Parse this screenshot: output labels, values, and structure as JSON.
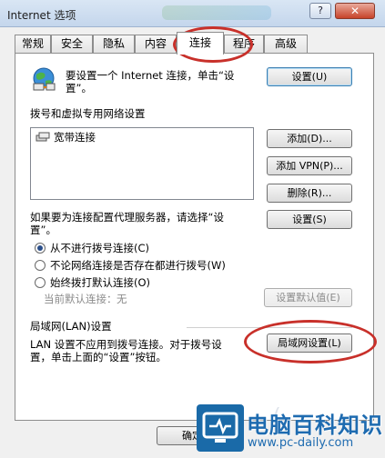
{
  "window": {
    "title": "Internet 选项",
    "help_label": "?",
    "close_label": "✕"
  },
  "tabs": [
    {
      "label": "常规"
    },
    {
      "label": "安全"
    },
    {
      "label": "隐私"
    },
    {
      "label": "内容"
    },
    {
      "label": "连接",
      "active": true
    },
    {
      "label": "程序"
    },
    {
      "label": "高级"
    }
  ],
  "setup": {
    "icon": "globe-network-icon",
    "text_line1": "要设置一个 Internet 连接，单击“设",
    "text_line2": "置”。",
    "button": "设置(U)"
  },
  "dialup": {
    "heading": "拨号和虚拟专用网络设置",
    "list_items": [
      {
        "icon": "broadband-connection-icon",
        "label": "宽带连接"
      }
    ],
    "add_button": "添加(D)...",
    "add_vpn_button": "添加 VPN(P)...",
    "remove_button": "删除(R)...",
    "proxy_text_line1": "如果要为连接配置代理服务器，请选择“设",
    "proxy_text_line2": "置”。",
    "settings_button": "设置(S)",
    "radio_options": [
      {
        "label": "从不进行拨号连接(C)",
        "checked": true
      },
      {
        "label": "不论网络连接是否存在都进行拨号(W)",
        "checked": false
      },
      {
        "label": "始终拨打默认连接(O)",
        "checked": false
      }
    ],
    "current_default_label": "当前默认连接：",
    "current_default_value": "无",
    "set_default_button": "设置默认值(E)"
  },
  "lan": {
    "heading": "局域网(LAN)设置",
    "text_line1": "LAN 设置不应用到拨号连接。对于拨号设",
    "text_line2": "置，单击上面的“设置”按钮。",
    "button": "局域网设置(L)"
  },
  "footer": {
    "ok_button": "确定"
  },
  "watermark": {
    "logo": "tv-monitor-logo-icon",
    "name": "电脑百科知识",
    "url": "www.pc-daily.com"
  },
  "annotation_color": "#c8302a"
}
